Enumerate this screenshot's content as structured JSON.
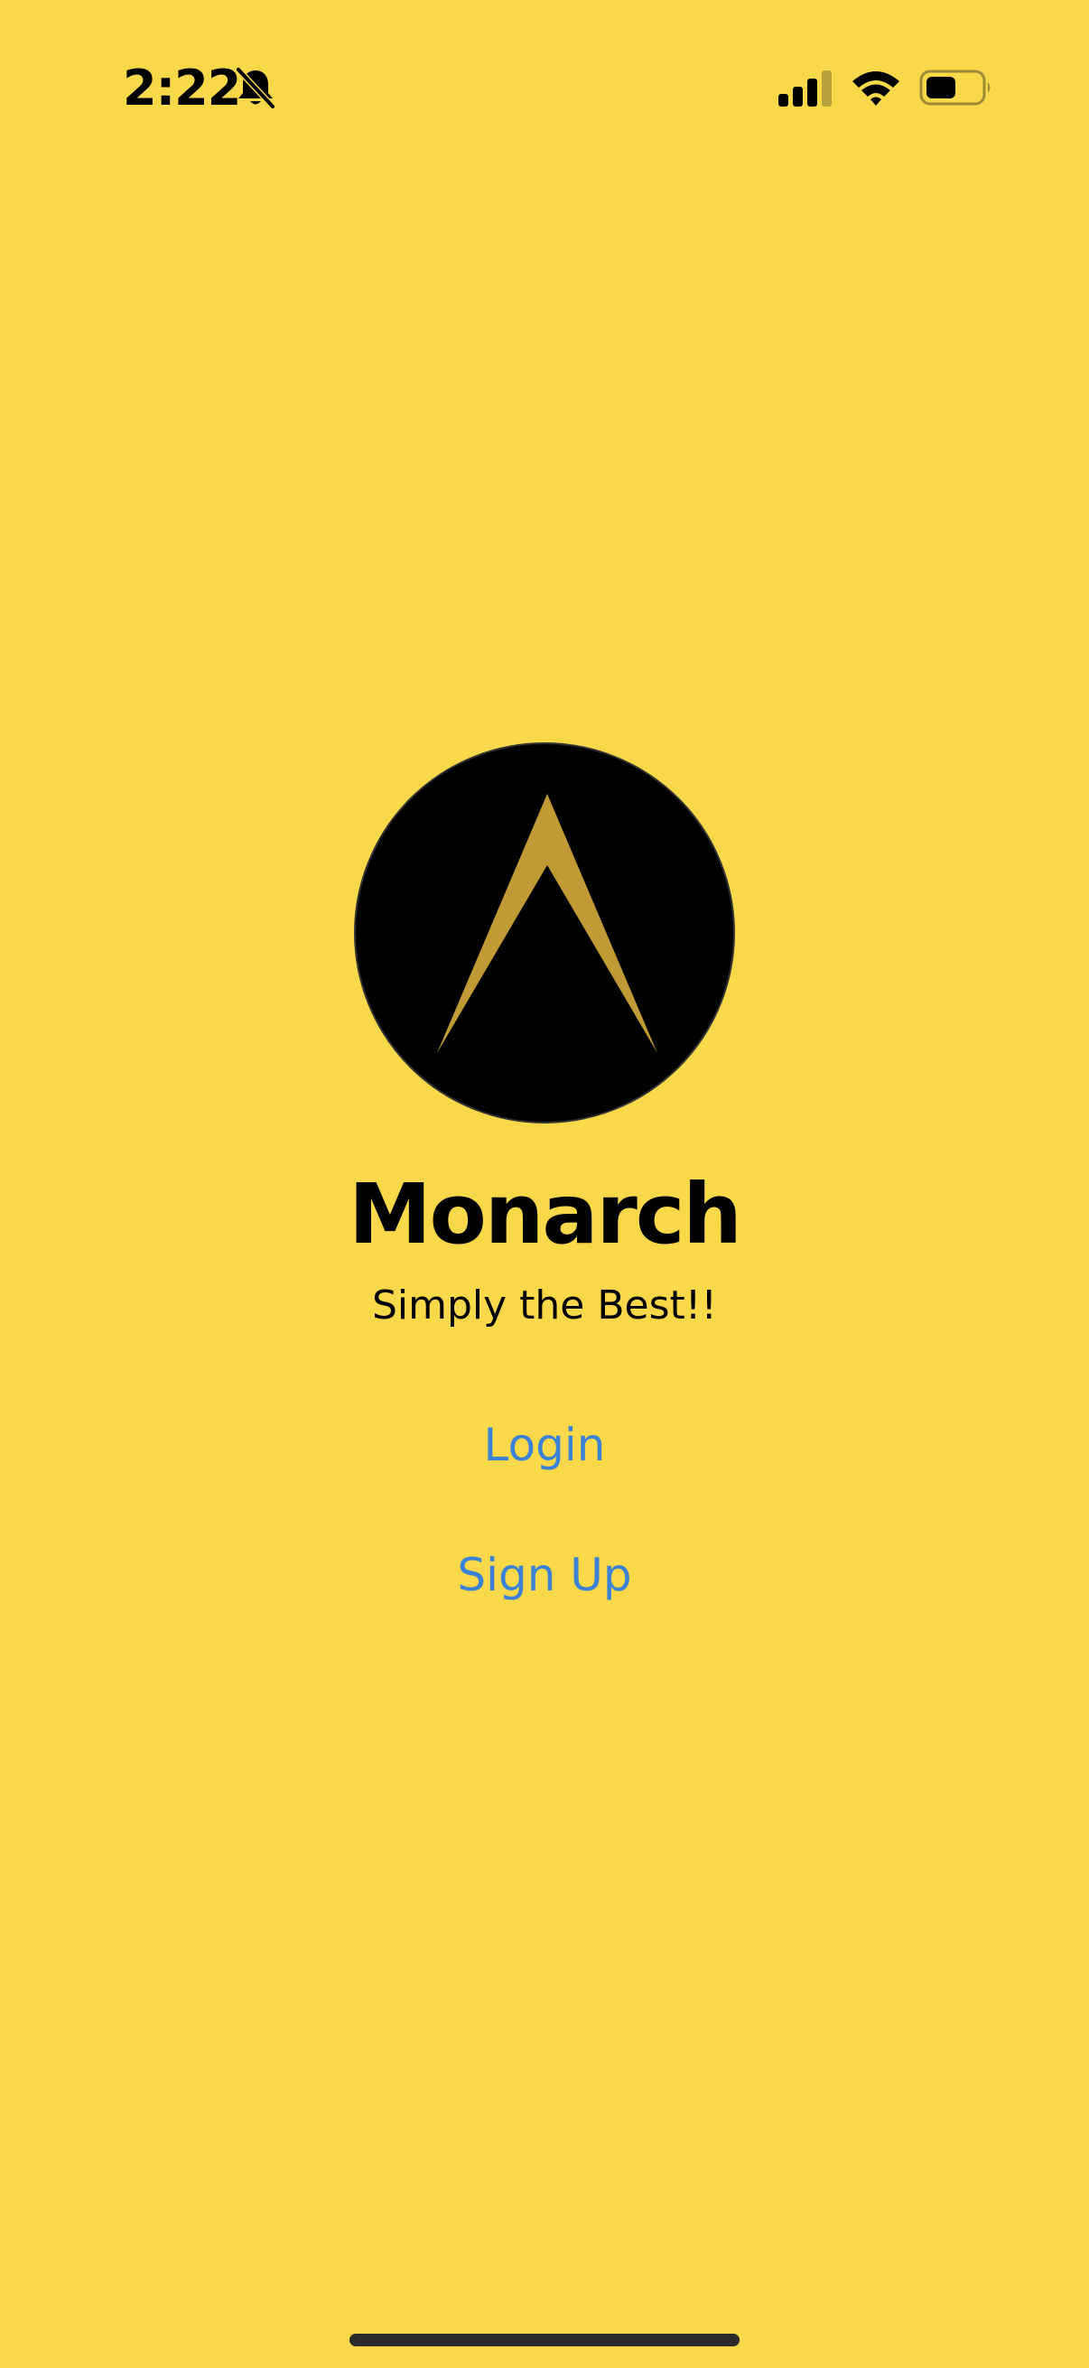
{
  "theme": {
    "background": "#F9D84A",
    "text": "#000000",
    "link": "#3B82D6",
    "logo_circle": "#000000",
    "logo_mark": "#C09A35",
    "home_indicator": "#2A2A2A"
  },
  "status_bar": {
    "time": "2:22",
    "icons": [
      "bell-slash-icon",
      "cellular-signal-icon",
      "wifi-icon",
      "battery-icon"
    ]
  },
  "app": {
    "logo_icon": "monarch-chevron-logo",
    "title": "Monarch",
    "tagline": "Simply the Best!!"
  },
  "actions": {
    "login_label": "Login",
    "signup_label": "Sign Up"
  }
}
